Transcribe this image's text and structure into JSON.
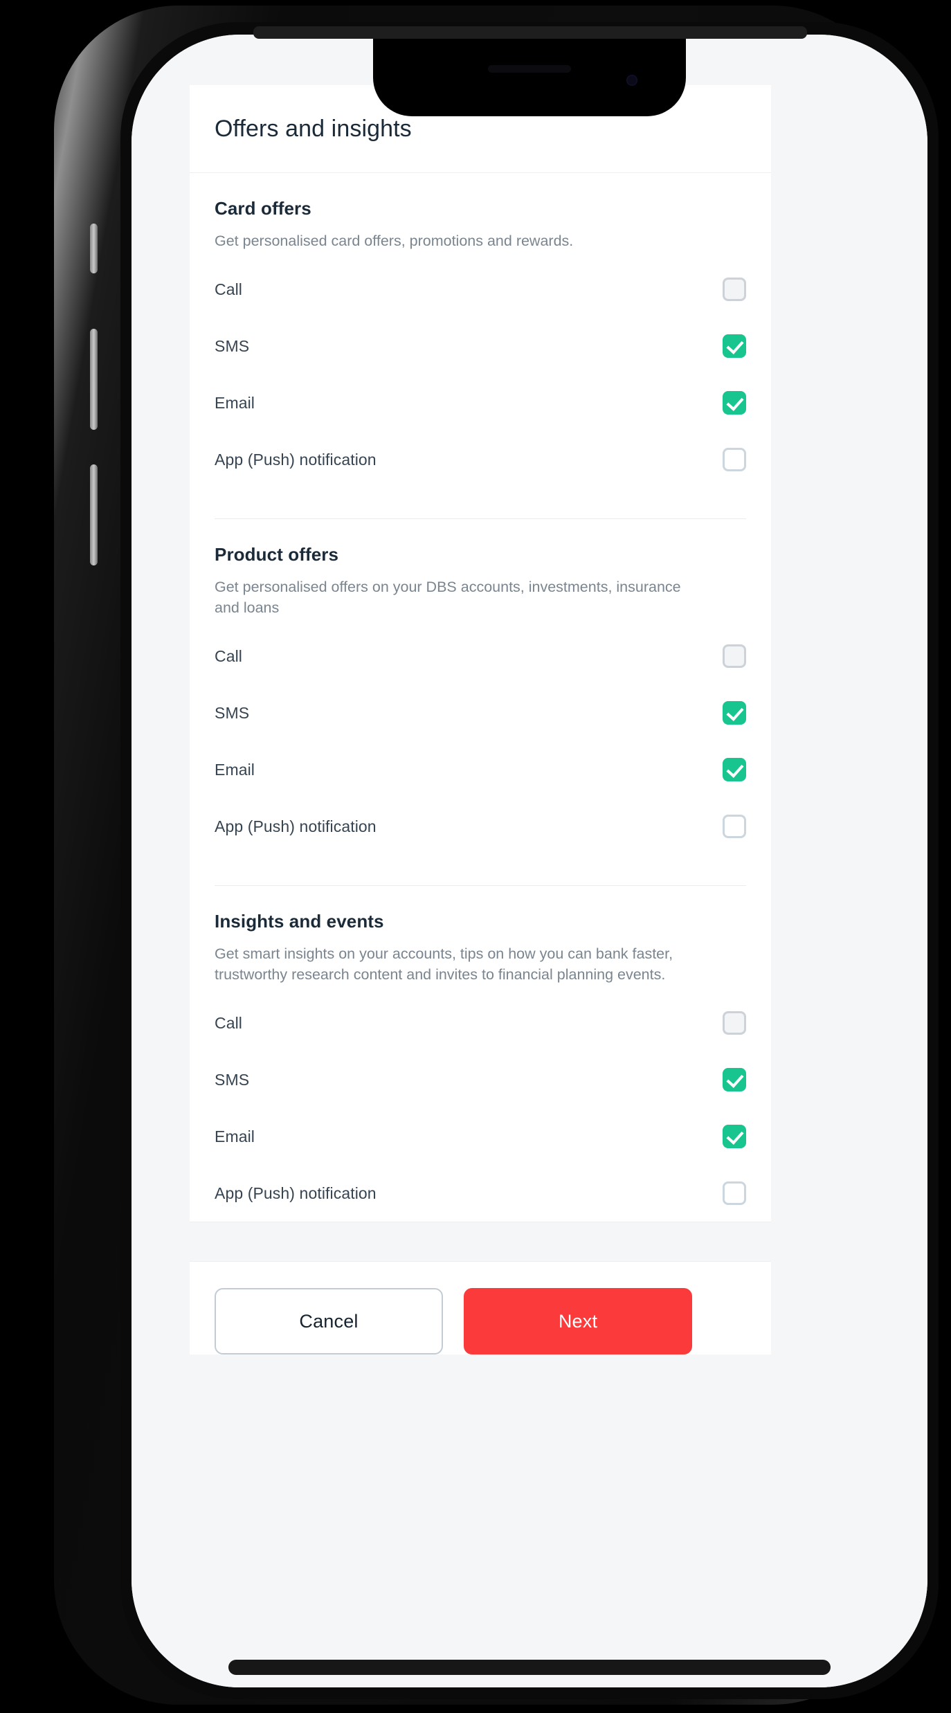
{
  "app": {
    "title": "Offers and insights"
  },
  "colors": {
    "checkbox_checked": "#18c58f",
    "checkbox_border": "#ccd6de",
    "primary_button": "#fb3b3b",
    "title_text": "#1b2a38",
    "description_text": "#7a858f",
    "screen_background": "#f4f6f8"
  },
  "sections": [
    {
      "title": "Card offers",
      "description": "Get personalised card offers, promotions and rewards.",
      "options": [
        {
          "label": "Call",
          "checked": false,
          "state": "disabled"
        },
        {
          "label": "SMS",
          "checked": true,
          "state": "enabled"
        },
        {
          "label": "Email",
          "checked": true,
          "state": "enabled"
        },
        {
          "label": "App (Push) notification",
          "checked": false,
          "state": "enabled"
        }
      ]
    },
    {
      "title": "Product offers",
      "description": "Get personalised offers on your DBS accounts, investments, insurance and loans",
      "options": [
        {
          "label": "Call",
          "checked": false,
          "state": "disabled"
        },
        {
          "label": "SMS",
          "checked": true,
          "state": "enabled"
        },
        {
          "label": "Email",
          "checked": true,
          "state": "enabled"
        },
        {
          "label": "App (Push) notification",
          "checked": false,
          "state": "enabled"
        }
      ]
    },
    {
      "title": "Insights and events",
      "description": "Get smart insights on your accounts, tips on how you can bank faster, trustworthy research content and invites to financial planning events.",
      "options": [
        {
          "label": "Call",
          "checked": false,
          "state": "disabled"
        },
        {
          "label": "SMS",
          "checked": true,
          "state": "enabled"
        },
        {
          "label": "Email",
          "checked": true,
          "state": "enabled"
        },
        {
          "label": "App (Push) notification",
          "checked": false,
          "state": "enabled"
        }
      ]
    }
  ],
  "footer": {
    "cancel_label": "Cancel",
    "next_label": "Next"
  }
}
